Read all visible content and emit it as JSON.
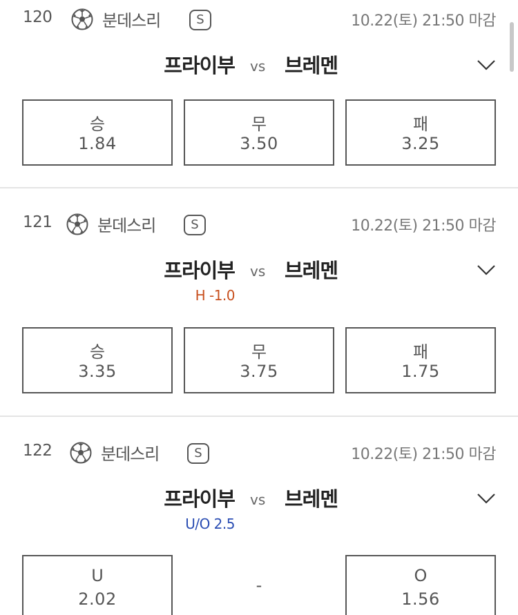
{
  "matches": [
    {
      "number": "120",
      "league": "분데스리",
      "badge": "S",
      "close_time": "10.22(토) 21:50 마감",
      "home": "프라이부",
      "vs": "vs",
      "away": "브레멘",
      "handicap": "",
      "odds": [
        {
          "label": "승",
          "value": "1.84"
        },
        {
          "label": "무",
          "value": "3.50"
        },
        {
          "label": "패",
          "value": "3.25"
        }
      ]
    },
    {
      "number": "121",
      "league": "분데스리",
      "badge": "S",
      "close_time": "10.22(토) 21:50 마감",
      "home": "프라이부",
      "vs": "vs",
      "away": "브레멘",
      "handicap": "H -1.0",
      "odds": [
        {
          "label": "승",
          "value": "3.35"
        },
        {
          "label": "무",
          "value": "3.75"
        },
        {
          "label": "패",
          "value": "1.75"
        }
      ]
    },
    {
      "number": "122",
      "league": "분데스리",
      "badge": "S",
      "close_time": "10.22(토) 21:50 마감",
      "home": "프라이부",
      "vs": "vs",
      "away": "브레멘",
      "handicap": "U/O 2.5",
      "odds": [
        {
          "label": "U",
          "value": "2.02"
        },
        {
          "label": "-",
          "value": ""
        },
        {
          "label": "O",
          "value": "1.56"
        }
      ]
    }
  ],
  "colors": {
    "handicap_red": "#c8501e",
    "uo_blue": "#2a4db3",
    "border": "#555555",
    "divider": "#e4e4e4"
  },
  "icons": {
    "sport": "soccer-ball-icon",
    "expand": "chevron-down-icon"
  }
}
